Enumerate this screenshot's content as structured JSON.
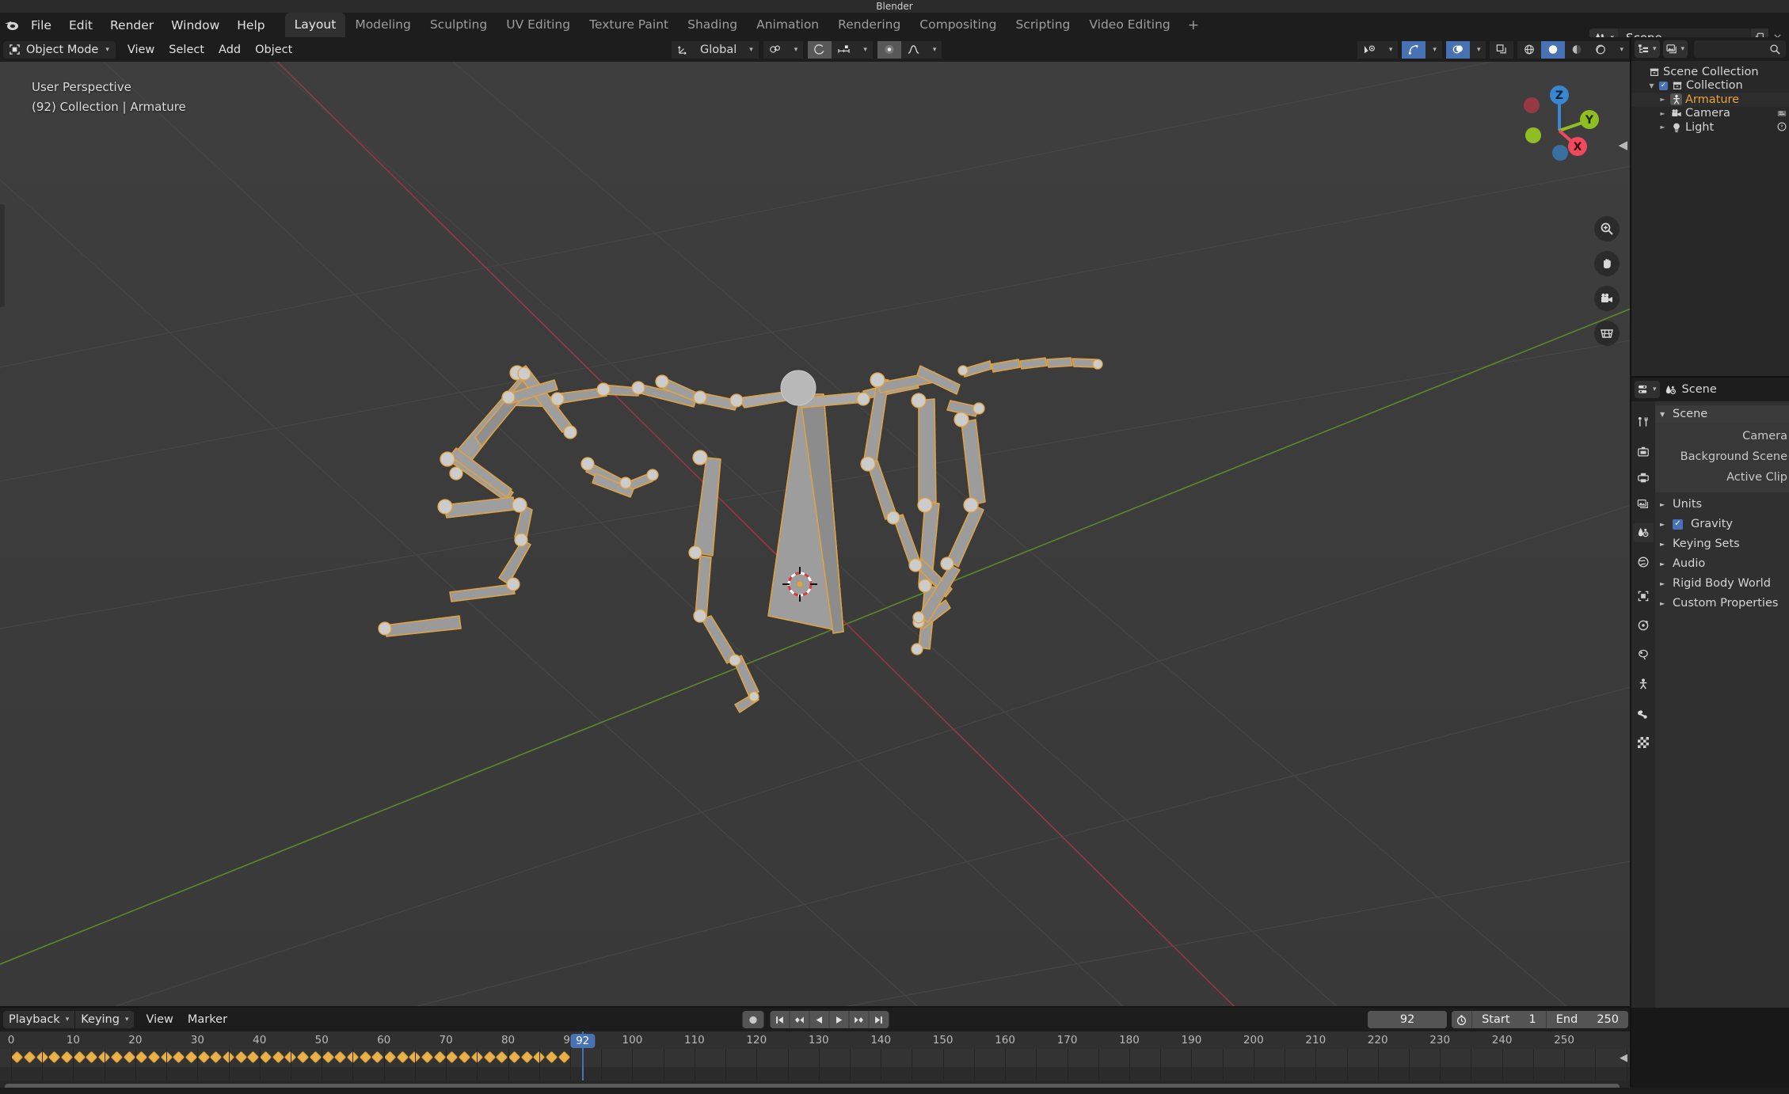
{
  "window": {
    "title": "Blender"
  },
  "topbar": {
    "menus": [
      "File",
      "Edit",
      "Render",
      "Window",
      "Help"
    ],
    "workspace_tabs": [
      {
        "label": "Layout",
        "active": true
      },
      {
        "label": "Modeling",
        "active": false
      },
      {
        "label": "Sculpting",
        "active": false
      },
      {
        "label": "UV Editing",
        "active": false
      },
      {
        "label": "Texture Paint",
        "active": false
      },
      {
        "label": "Shading",
        "active": false
      },
      {
        "label": "Animation",
        "active": false
      },
      {
        "label": "Rendering",
        "active": false
      },
      {
        "label": "Compositing",
        "active": false
      },
      {
        "label": "Scripting",
        "active": false
      },
      {
        "label": "Video Editing",
        "active": false
      }
    ],
    "add_workspace_label": "+",
    "scene_name": "Scene"
  },
  "viewport_header": {
    "mode": "Object Mode",
    "menus": [
      "View",
      "Select",
      "Add",
      "Object"
    ],
    "transform_orientation": "Global"
  },
  "viewport": {
    "overlay_line1": "User Perspective",
    "overlay_line2": "(92) Collection | Armature",
    "gizmo_axes": [
      "X",
      "Y",
      "Z"
    ],
    "gizmo_colors": {
      "x": "#f0485c",
      "y": "#8fbe23",
      "z": "#3b86d1"
    },
    "side_icons": [
      "zoom-icon",
      "hand-icon",
      "camera-icon",
      "grid-icon"
    ]
  },
  "outliner": {
    "search_placeholder": "",
    "rows": [
      {
        "label": "Scene Collection",
        "icon": "collection-icon",
        "indent": 0,
        "has_tri": false,
        "has_checkbox": false,
        "active": false
      },
      {
        "label": "Collection",
        "icon": "collection-icon",
        "indent": 1,
        "has_tri": true,
        "has_checkbox": true,
        "active": false
      },
      {
        "label": "Armature",
        "icon": "armature-icon",
        "indent": 2,
        "has_tri": true,
        "has_checkbox": false,
        "active": true
      },
      {
        "label": "Camera",
        "icon": "camera-icon",
        "indent": 2,
        "has_tri": true,
        "has_checkbox": false,
        "active": false
      },
      {
        "label": "Light",
        "icon": "light-icon",
        "indent": 2,
        "has_tri": true,
        "has_checkbox": false,
        "active": false
      }
    ]
  },
  "properties": {
    "breadcrumb": "Scene",
    "tabs": [
      "tool-icon",
      "render-icon",
      "output-icon",
      "view-layer-icon",
      "scene-icon",
      "world-icon",
      "object-icon",
      "physics-icon",
      "constraints-icon",
      "data-icon",
      "modifier-icon",
      "texture-icon"
    ],
    "active_tab_index": 4,
    "panel_title": "Scene",
    "fields": [
      {
        "label": "Camera"
      },
      {
        "label": "Background Scene"
      },
      {
        "label": "Active Clip"
      }
    ],
    "sections": [
      {
        "label": "Units",
        "open": false,
        "checkbox": false
      },
      {
        "label": "Gravity",
        "open": false,
        "checkbox": true,
        "checked": true
      },
      {
        "label": "Keying Sets",
        "open": false,
        "checkbox": false
      },
      {
        "label": "Audio",
        "open": false,
        "checkbox": false
      },
      {
        "label": "Rigid Body World",
        "open": false,
        "checkbox": false
      },
      {
        "label": "Custom Properties",
        "open": false,
        "checkbox": false
      }
    ]
  },
  "timeline": {
    "dropdowns": [
      "Playback",
      "Keying"
    ],
    "menus": [
      "View",
      "Marker"
    ],
    "transport": [
      "record-icon",
      "jump-start-icon",
      "prev-keyframe-icon",
      "play-reverse-icon",
      "play-icon",
      "next-keyframe-icon",
      "jump-end-icon"
    ],
    "current_frame": "92",
    "start_label": "Start",
    "start_value": "1",
    "end_label": "End",
    "end_value": "250",
    "ruler_ticks": [
      "0",
      "10",
      "20",
      "30",
      "40",
      "50",
      "60",
      "70",
      "80",
      "90",
      "100",
      "110",
      "120",
      "130",
      "140",
      "150",
      "160",
      "170",
      "180",
      "190",
      "200",
      "210",
      "220",
      "230",
      "240",
      "250"
    ],
    "playhead_frame": 92,
    "keyframes": [
      1,
      3,
      5,
      7,
      9,
      11,
      13,
      15,
      17,
      19,
      21,
      23,
      25,
      27,
      29,
      31,
      33,
      35,
      37,
      39,
      41,
      43,
      45,
      47,
      49,
      51,
      53,
      55,
      57,
      59,
      61,
      63,
      65,
      67,
      69,
      71,
      73,
      75,
      77,
      79,
      81,
      83,
      85,
      87,
      89
    ],
    "keyframe_color": "#e8b14c",
    "playhead_color": "#4772b3"
  }
}
